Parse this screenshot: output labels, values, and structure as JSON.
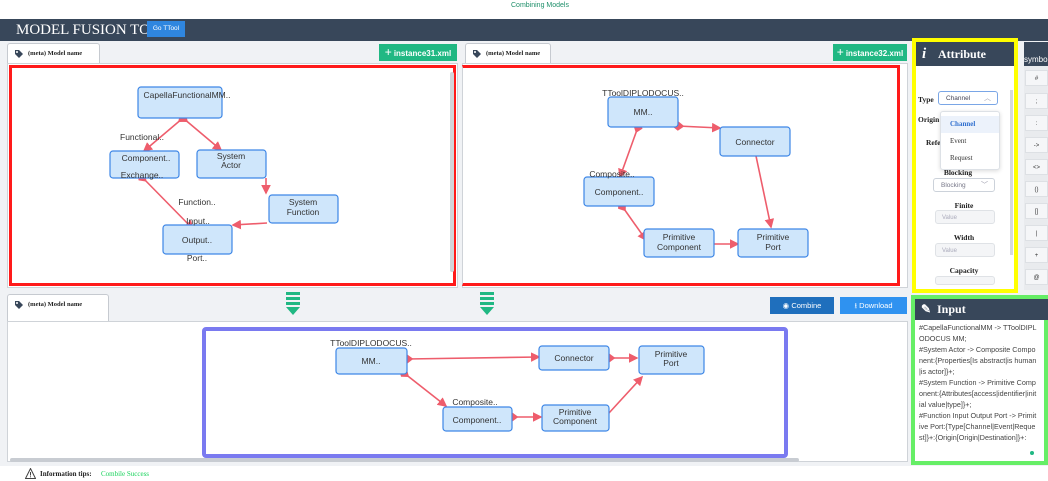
{
  "header": {
    "top_caption": "Combining Models",
    "app_title": "MODEL FUSION TOOL",
    "ttool_button": "Go TTool"
  },
  "left_panel": {
    "tab_label": "(meta) Model name",
    "xml_button": "instance31.xml",
    "nodes": {
      "capella": "CapellaFunctionalMM..",
      "component_a": "Component..",
      "exchange": "Exchange..",
      "system_actor_1": "System",
      "system_actor_2": "Actor",
      "system_function_1": "System",
      "system_function_2": "Function",
      "output": "Output..",
      "functional": "Functional..",
      "function": "Function..",
      "input": "Input..",
      "port": "Port.."
    }
  },
  "right_panel": {
    "tab_label": "(meta) Model name",
    "xml_button": "instance32.xml",
    "nodes": {
      "ttool": "TToolDIPLODOCUS..",
      "mm": "MM..",
      "connector": "Connector",
      "composite": "Composite..",
      "component": "Component..",
      "primitive_component_1": "Primitive",
      "primitive_component_2": "Component",
      "primitive_port_1": "Primitive",
      "primitive_port_2": "Port"
    }
  },
  "attribute_panel": {
    "title": "Attribute",
    "type_label": "Type",
    "type_value": "Channel",
    "origin_label": "Origin",
    "refer_label": "Refe",
    "dropdown_options": [
      "Channel",
      "Event",
      "Request"
    ],
    "blocking_label": "Blocking",
    "blocking_value": "Blocking",
    "finite_label": "Finite",
    "finite_placeholder": "Value",
    "width_label": "Width",
    "width_placeholder": "Value",
    "capacity_label": "Capacity"
  },
  "symbol_panel": {
    "title": "symbo",
    "buttons": [
      "#",
      ";",
      ":",
      "->",
      "<>",
      "()",
      "[]",
      "|",
      "+",
      "@"
    ]
  },
  "bottom_panel": {
    "tab_label": "(meta) Model name",
    "combine_button": "Combine",
    "download_button": "Download",
    "nodes": {
      "ttool": "TToolDIPLODOCUS..",
      "mm": "MM..",
      "connector": "Connector",
      "primitive_port_1": "Primitive",
      "primitive_port_2": "Port",
      "composite": "Composite..",
      "component": "Component..",
      "primitive_component_1": "Primitive",
      "primitive_component_2": "Component"
    }
  },
  "input_panel": {
    "title": "Input",
    "text": "#CapellaFunctionalMM -> TToolDIPLODOCUS MM;\n#System Actor -> Composite Component:{Properties[Is abstract|is human|is actor]}+;\n#System Function -> Primitive Component:{Attributes[access|identifier|initial value|type]}+;\n#Function Input Output Port -> Primitive Port:{Type[Channel|Event|Request]}+:{Origin[Origin|Destination]}+:"
  },
  "footer": {
    "tips_label": "Information tips:",
    "tips_value": "Combile Success"
  },
  "colors": {
    "header_bg": "#38475a",
    "node_fill": "#cfe6fb",
    "node_stroke": "#3d86e6",
    "edge": "#ee5d6c",
    "highlight_red": "#ff1a1a",
    "highlight_yellow": "#ffff00",
    "highlight_blue": "#7a7af0",
    "highlight_green": "#66ee66",
    "xml_button": "#20b883",
    "success_text": "#19d35c"
  }
}
